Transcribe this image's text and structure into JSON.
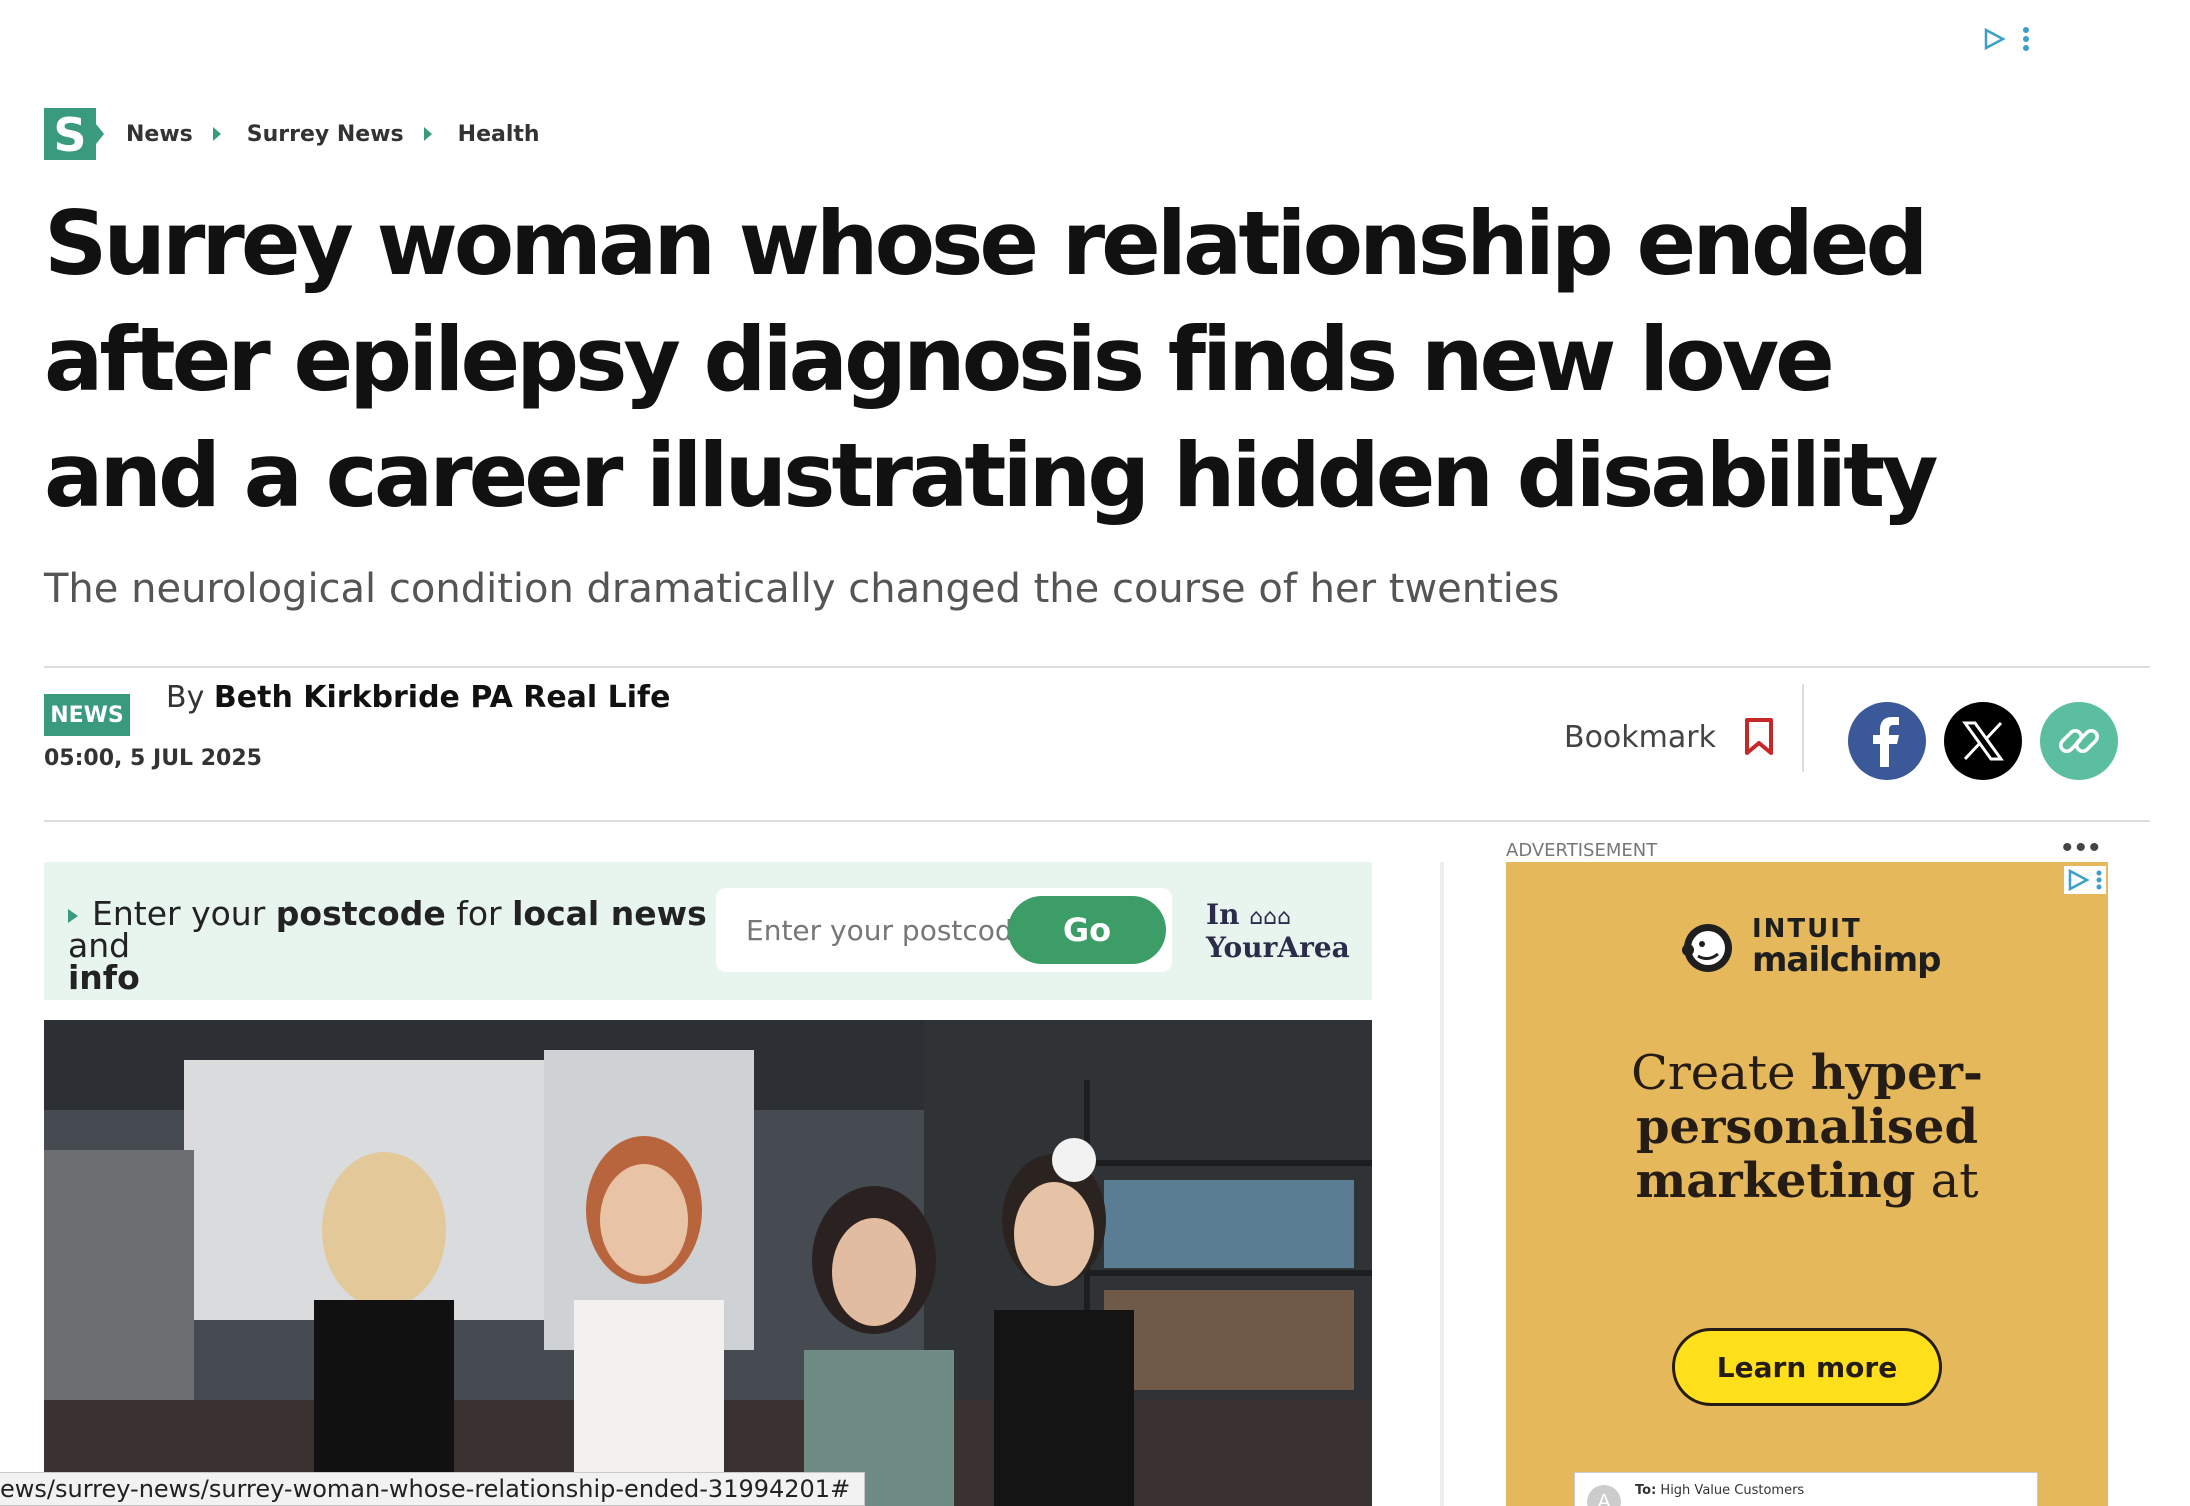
{
  "breadcrumb": {
    "logo_letter": "S",
    "items": [
      "News",
      "Surrey News",
      "Health"
    ]
  },
  "article": {
    "headline": "Surrey woman whose relationship ended after epilepsy diagnosis finds new love and a career illustrating hidden disability",
    "standfirst": "The neurological condition dramatically changed the course of her twenties",
    "category_badge": "NEWS",
    "byline_prefix": "By",
    "author": "Beth Kirkbride PA Real Life",
    "timestamp": "05:00, 5 JUL 2025"
  },
  "share": {
    "bookmark_label": "Bookmark",
    "icons": [
      "bookmark-icon",
      "facebook-icon",
      "x-icon",
      "link-icon"
    ]
  },
  "postcode": {
    "prompt_1": "Enter your",
    "prompt_2": "postcode",
    "prompt_3": "for",
    "prompt_4": "local news",
    "prompt_5": "and",
    "prompt_6": "info",
    "placeholder": "Enter your postcode",
    "button_label": "Go",
    "brand_line1": "In",
    "brand_houses": "⌂⌂⌂",
    "brand_line2": "YourArea"
  },
  "advert": {
    "label": "ADVERTISEMENT",
    "brand_top": "INTUIT",
    "brand_bottom": "mailchimp",
    "headline_1": "Create",
    "headline_2": "hyper-",
    "headline_3": "personalised",
    "headline_4": "marketing",
    "headline_5": "at",
    "cta": "Learn more",
    "email_to_label": "To:",
    "email_to_value": "High Value Customers",
    "email_avatar": "A"
  },
  "status_bar": {
    "url": "ews/surrey-news/surrey-woman-whose-relationship-ended-31994201#"
  },
  "colors": {
    "brand_green": "#3a9a7e",
    "go_button": "#3c9d66",
    "facebook": "#3b5998",
    "ad_background": "#e6b85c",
    "ad_cta": "#ffe01b"
  }
}
